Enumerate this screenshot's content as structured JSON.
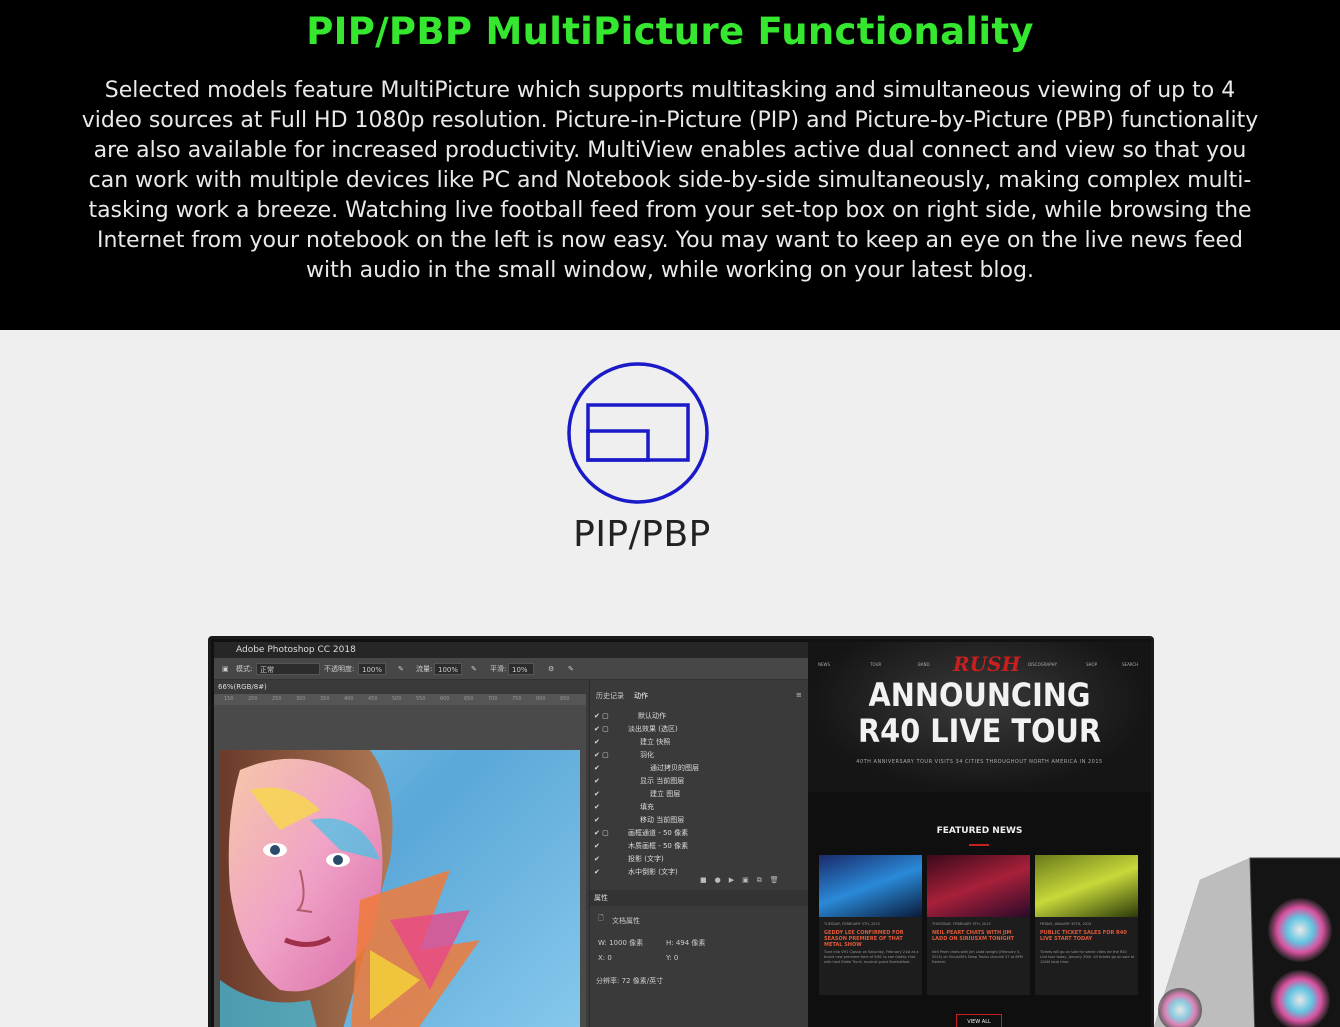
{
  "hero": {
    "title": "PIP/PBP MultiPicture Functionality",
    "description": "Selected models feature MultiPicture which supports multitasking and simultaneous viewing of up to 4 video sources at Full HD 1080p resolution. Picture-in-Picture (PIP) and Picture-by-Picture (PBP) functionality are also available for increased productivity. MultiView enables active dual connect and view so that you can work with multiple devices like PC and Notebook side-by-side simultaneously, making complex multi-tasking work a breeze. Watching live football feed from your set-top box on right side, while browsing the Internet from your notebook on the left is now easy. You may want to keep an eye on the live news feed with audio in the small window, while working on your latest blog."
  },
  "feature": {
    "icon": "pip-window-icon",
    "label": "PIP/PBP"
  },
  "photoshop": {
    "app_title": "Adobe Photoshop CC 2018",
    "toolbar": {
      "mode_label": "模式:",
      "mode_value": "正常",
      "opacity_label": "不透明度:",
      "opacity_value": "100%",
      "flow_label": "流量:",
      "flow_value": "100%",
      "smooth_label": "平滑:",
      "smooth_value": "10%"
    },
    "doc_tab": "66%(RGB/8#)",
    "ruler": [
      "150",
      "200",
      "250",
      "300",
      "350",
      "400",
      "450",
      "500",
      "550",
      "600",
      "650",
      "700",
      "750",
      "800",
      "850"
    ],
    "panel_tabs": [
      "历史记录",
      "动作"
    ],
    "actions": [
      {
        "indent": 0,
        "text": "默认动作"
      },
      {
        "indent": 1,
        "text": "淡出效果 (选区)"
      },
      {
        "indent": 2,
        "text": "建立 快照"
      },
      {
        "indent": 2,
        "text": "羽化"
      },
      {
        "indent": 2,
        "text": "通过拷贝的图层"
      },
      {
        "indent": 2,
        "text": "显示 当前图层"
      },
      {
        "indent": 2,
        "text": "建立 图层"
      },
      {
        "indent": 2,
        "text": "填充"
      },
      {
        "indent": 2,
        "text": "移动 当前图层"
      },
      {
        "indent": 1,
        "text": "画框通道 - 50 像素"
      },
      {
        "indent": 1,
        "text": "木质画框 - 50 像素"
      },
      {
        "indent": 1,
        "text": "投影 (文字)"
      },
      {
        "indent": 1,
        "text": "水中倒影 (文字)"
      }
    ],
    "properties": {
      "header": "属性",
      "doc_props": "文档属性",
      "w": "W: 1000 像素",
      "h": "H: 494 像素",
      "x": "X: 0",
      "y": "Y: 0",
      "resolution": "分辨率: 72 像素/英寸"
    }
  },
  "rush": {
    "logo": "RUSH",
    "nav": [
      "NEWS",
      "TOUR",
      "BAND",
      "DISCOGRAPHY",
      "SHOP",
      "SEARCH"
    ],
    "headline_1": "ANNOUNCING",
    "headline_2": "R40 LIVE TOUR",
    "subhead": "40TH ANNIVERSARY TOUR VISITS 34 CITIES THROUGHOUT NORTH AMERICA IN 2015",
    "featured": "FEATURED NEWS",
    "cards": [
      {
        "date": "TUESDAY, FEBRUARY 3TH, 2015",
        "headline": "GEDDY LEE CONFIRMED FOR SEASON PREMIERE OF THAT METAL SHOW",
        "body": "Tune into VH1 Classic on Saturday, February 21st at a brand new premiere time of 9/8C to see Geddy chat with host Eddie Trunk, musical guest Bumblefoot."
      },
      {
        "date": "THURSDAY, FEBRUARY 5TH, 2015",
        "headline": "NEIL PEART CHATS WITH JIM LADD ON SIRIUSXM TONIGHT",
        "body": "Neil Peart chats with Jim Ladd tonight (February 5, 2015) on SiriusXM's Deep Tracks channel 27 at 8PM Eastern."
      },
      {
        "date": "FRIDAY, JANUARY 30TH, 2015",
        "headline": "PUBLIC TICKET SALES FOR R40 LIVE START TODAY",
        "body": "Tickets will go on sale for select cities for the R40 Live tour today, January 30th. All tickets go on sale at 10AM local time."
      }
    ],
    "view_all": "VIEW ALL"
  },
  "colors": {
    "accent_green": "#35e82f",
    "icon_blue": "#1a1ac8",
    "rush_red": "#c81f1f"
  }
}
